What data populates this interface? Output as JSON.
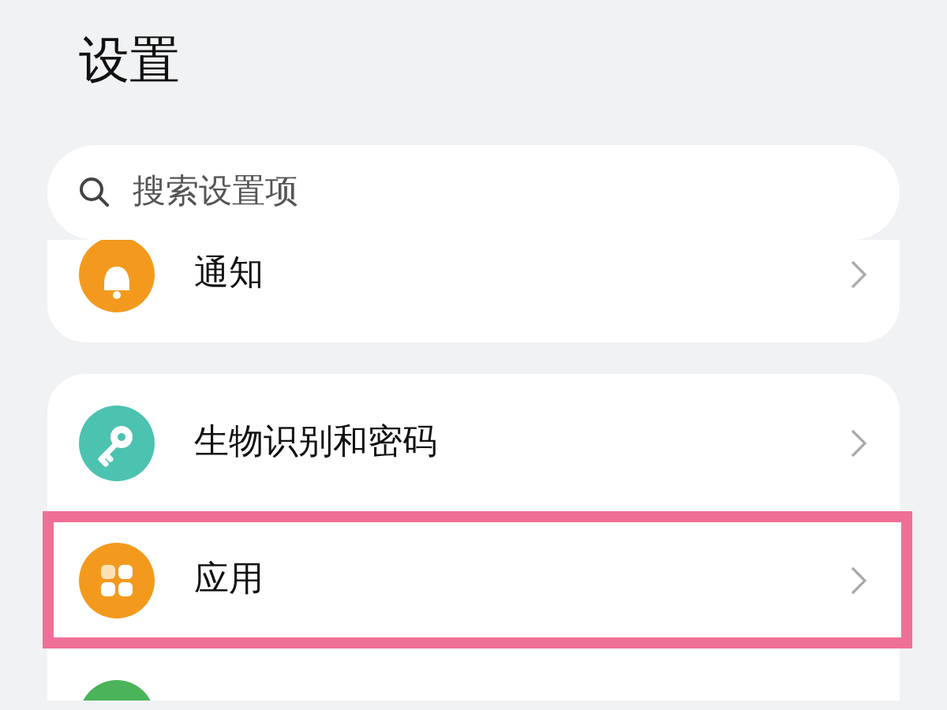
{
  "title": "设置",
  "search": {
    "placeholder": "搜索设置项"
  },
  "groups": [
    {
      "items": [
        {
          "label": "通知",
          "kind": "bell",
          "color": "#f39a1e",
          "highlighted": false
        }
      ]
    },
    {
      "items": [
        {
          "label": "生物识别和密码",
          "kind": "key",
          "color": "#4cc2b0",
          "highlighted": false
        },
        {
          "label": "应用",
          "kind": "apps",
          "color": "#f39a1e",
          "highlighted": true
        },
        {
          "kind": "blank",
          "color": "#4bb45a",
          "highlighted": false
        }
      ]
    }
  ]
}
